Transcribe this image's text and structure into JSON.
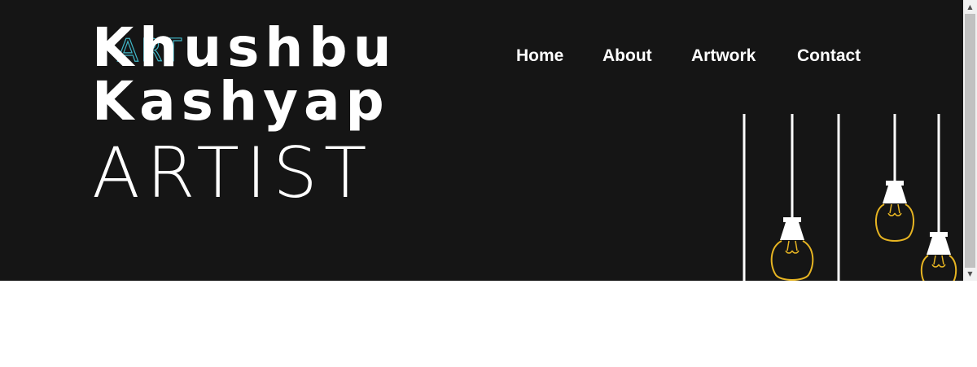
{
  "header": {
    "logo_ghost_text": "ART",
    "name_line1": "Khushbu",
    "name_line2": "Kashyap",
    "role": "ARTIST"
  },
  "nav": {
    "items": [
      {
        "label": "Home"
      },
      {
        "label": "About"
      },
      {
        "label": "Artwork"
      },
      {
        "label": "Contact"
      }
    ]
  },
  "decoration": {
    "bulb_icon": "hanging-light-bulb",
    "bulb_color": "#e6b422",
    "cord_color": "#ffffff"
  },
  "colors": {
    "hero_background": "#151515",
    "text": "#ffffff",
    "logo_outline": "#3fb6c7",
    "page_background": "#ffffff"
  },
  "scrollbar": {
    "up_arrow": "▲",
    "down_arrow": "▼"
  }
}
